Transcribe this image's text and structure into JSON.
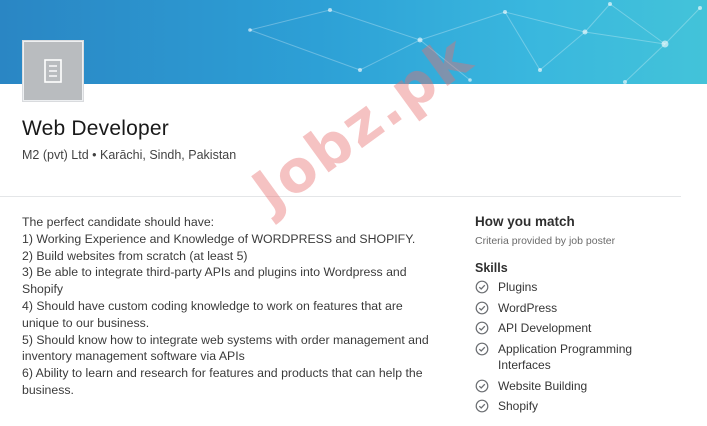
{
  "banner": {
    "accent_colors": [
      "#2a86c4",
      "#43c3d9"
    ]
  },
  "company_logo": {
    "icon": "building-icon"
  },
  "job": {
    "title": "Web Developer",
    "meta": "M2 (pvt) Ltd • Karāchi, Sindh, Pakistan"
  },
  "description": {
    "lines": [
      "The perfect candidate should have:",
      "1) Working Experience and Knowledge of WORDPRESS and SHOPIFY.",
      "2) Build websites from scratch (at least 5)",
      "3) Be able to integrate third-party APIs and plugins into Wordpress and",
      "Shopify",
      "4) Should have custom coding knowledge to work on features that are",
      "unique to our business.",
      "5) Should know how to integrate web systems with order management and",
      "inventory management software via APIs",
      "6) Ability to learn and research for features and products that can help the",
      "business."
    ]
  },
  "match": {
    "title": "How you match",
    "subtitle": "Criteria provided by job poster",
    "skills_title": "Skills",
    "skills": [
      "Plugins",
      "WordPress",
      "API Development",
      "Application Programming Interfaces",
      "Website Building",
      "Shopify"
    ],
    "check_icon": "check-circle-icon"
  },
  "watermark": {
    "text": "Jobz.pk",
    "color": "#e86e6e"
  }
}
